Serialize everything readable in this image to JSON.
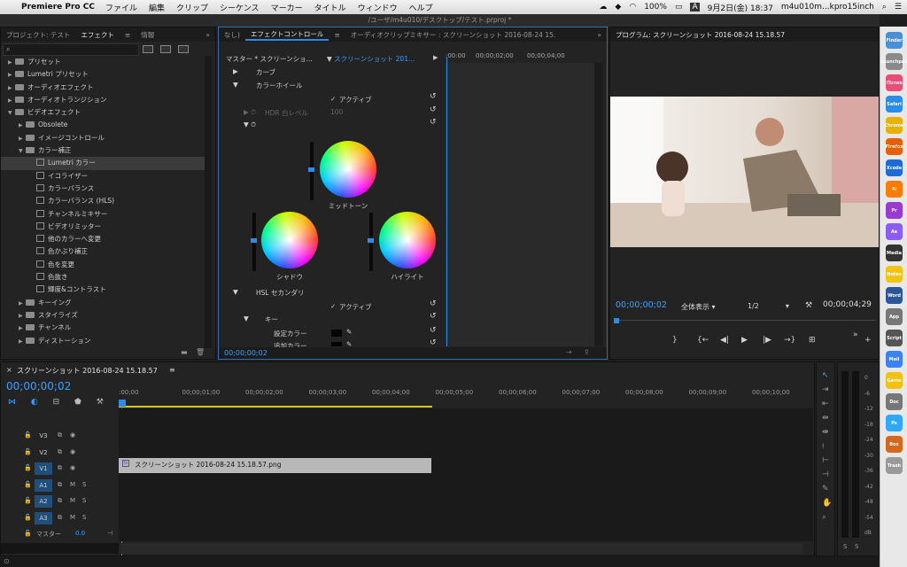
{
  "menubar": {
    "apple": "",
    "app": "Premiere Pro CC",
    "items": [
      "ファイル",
      "編集",
      "クリップ",
      "シーケンス",
      "マーカー",
      "タイトル",
      "ウィンドウ",
      "ヘルプ"
    ],
    "battery": "100%",
    "input": "A",
    "datetime": "9月2日(金)  18:37",
    "user": "m4u010m...kpro15inch"
  },
  "title": "/ユーザ/m4u010/デスクトップ/テスト.prproj *",
  "left_panel": {
    "tabs": [
      "プロジェクト: テスト",
      "エフェクト",
      "≡",
      "情報",
      "»"
    ],
    "search_placeholder": "",
    "tree": [
      {
        "label": "プリセット",
        "level": 0,
        "type": "folder",
        "arrow": "▶"
      },
      {
        "label": "Lumetri プリセット",
        "level": 0,
        "type": "folder",
        "arrow": "▶"
      },
      {
        "label": "オーディオエフェクト",
        "level": 0,
        "type": "folder",
        "arrow": "▶"
      },
      {
        "label": "オーディオトランジション",
        "level": 0,
        "type": "folder",
        "arrow": "▶"
      },
      {
        "label": "ビデオエフェクト",
        "level": 0,
        "type": "folder",
        "arrow": "▼"
      },
      {
        "label": "Obsolete",
        "level": 1,
        "type": "folder",
        "arrow": "▶"
      },
      {
        "label": "イメージコントロール",
        "level": 1,
        "type": "folder",
        "arrow": "▶"
      },
      {
        "label": "カラー補正",
        "level": 1,
        "type": "folder",
        "arrow": "▼"
      },
      {
        "label": "Lumetri カラー",
        "level": 2,
        "type": "fx",
        "arrow": "",
        "selected": true
      },
      {
        "label": "イコライザー",
        "level": 2,
        "type": "fx",
        "arrow": ""
      },
      {
        "label": "カラーバランス",
        "level": 2,
        "type": "fx",
        "arrow": ""
      },
      {
        "label": "カラーバランス (HLS)",
        "level": 2,
        "type": "fx",
        "arrow": ""
      },
      {
        "label": "チャンネルミキサー",
        "level": 2,
        "type": "fx",
        "arrow": ""
      },
      {
        "label": "ビデオリミッター",
        "level": 2,
        "type": "fx",
        "arrow": ""
      },
      {
        "label": "他のカラーへ変更",
        "level": 2,
        "type": "fx",
        "arrow": ""
      },
      {
        "label": "色かぶり補正",
        "level": 2,
        "type": "fx",
        "arrow": ""
      },
      {
        "label": "色を変更",
        "level": 2,
        "type": "fx",
        "arrow": ""
      },
      {
        "label": "色抜き",
        "level": 2,
        "type": "fx",
        "arrow": ""
      },
      {
        "label": "輝度&コントラスト",
        "level": 2,
        "type": "fx",
        "arrow": ""
      },
      {
        "label": "キーイング",
        "level": 1,
        "type": "folder",
        "arrow": "▶"
      },
      {
        "label": "スタイライズ",
        "level": 1,
        "type": "folder",
        "arrow": "▶"
      },
      {
        "label": "チャンネル",
        "level": 1,
        "type": "folder",
        "arrow": "▶"
      },
      {
        "label": "ディストーション",
        "level": 1,
        "type": "folder",
        "arrow": "▶"
      }
    ]
  },
  "effect_controls": {
    "tabs": [
      "なし)",
      "エフェクトコントロール",
      "≡",
      "オーディオクリップミキサー : スクリーンショット 2016-08-24 15.",
      "»"
    ],
    "master": "マスター * スクリーンショ...",
    "clip": "スクリーンショット 201...",
    "mini_ruler": [
      ":00:00",
      "00;00;02;00",
      "00;00;04;00"
    ],
    "curve": "カーブ",
    "color_wheel": "カラーホイール",
    "active": "アクティブ",
    "hdr": "HDR 白レベル",
    "hdr_value": "100",
    "midtone": "ミッドトーン",
    "shadow": "シャドウ",
    "highlight": "ハイライト",
    "hsl": "HSL セカンダリ",
    "key": "キー",
    "set_color": "設定カラー",
    "add_color": "追加カラー",
    "timecode": "00;00;00;02"
  },
  "program": {
    "title": "プログラム: スクリーンショット 2016-08-24 15.18.57",
    "timecode": "00;00;00;02",
    "fit": "全体表示",
    "quality": "1/2",
    "duration": "00;00;04;29"
  },
  "timeline": {
    "title": "スクリーンショット 2016-08-24 15.18.57",
    "timecode": "00;00;00;02",
    "ruler": [
      ":00;00",
      "00;00;01;00",
      "00;00;02;00",
      "00;00;03;00",
      "00;00;04;00",
      "00;00;05;00",
      "00;00;06;00",
      "00;00;07;00",
      "00;00;08;00",
      "00;00;09;00",
      "00;00;10;00",
      "00;00"
    ],
    "tracks": [
      {
        "name": "V3",
        "mute": "",
        "solo": ""
      },
      {
        "name": "V2",
        "mute": "",
        "solo": ""
      },
      {
        "name": "V1",
        "mute": "",
        "solo": ""
      },
      {
        "name": "A1",
        "mute": "M",
        "solo": "S"
      },
      {
        "name": "A2",
        "mute": "M",
        "solo": "S"
      },
      {
        "name": "A3",
        "mute": "M",
        "solo": "S"
      }
    ],
    "master": "マスター",
    "master_value": "0.0",
    "clip": "スクリーンショット 2016-08-24 15.18.57.png"
  },
  "meter": {
    "scale": [
      "0",
      "-6",
      "-12",
      "-18",
      "-24",
      "-30",
      "-36",
      "-42",
      "-48",
      "-54",
      "dB"
    ],
    "s": "S"
  },
  "dock": [
    "Finder",
    "Launchpad",
    "iTunes",
    "Safari",
    "Chrome",
    "Firefox",
    "Xcode",
    "Ai",
    "Pr",
    "Ae",
    "Media",
    "Notes",
    "Word",
    "App",
    "Script",
    "Mail",
    "Game",
    "Doc",
    "Ps",
    "Box",
    "Trash"
  ]
}
